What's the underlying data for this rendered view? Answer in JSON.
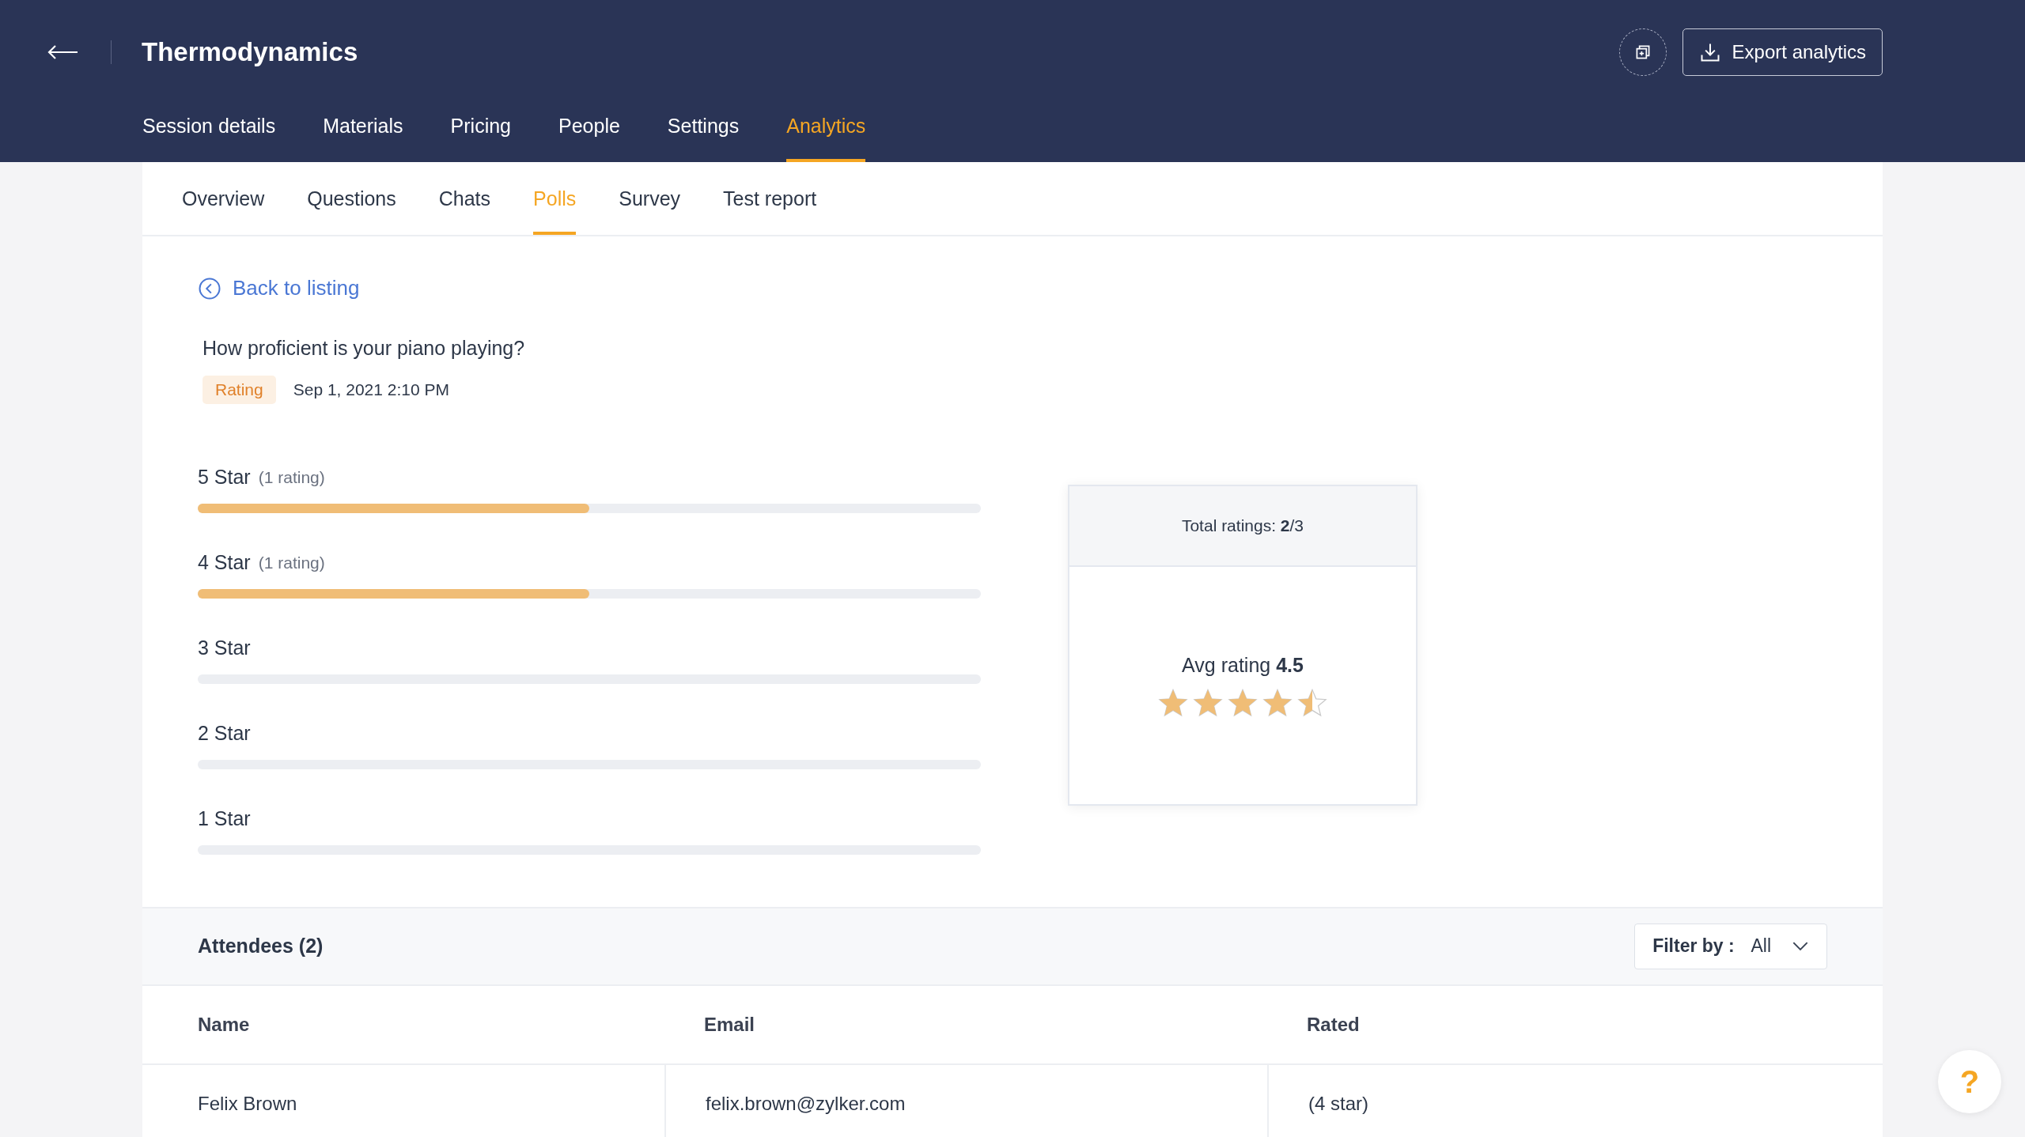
{
  "header": {
    "title": "Thermodynamics",
    "export_button": "Export analytics"
  },
  "nav_tabs": [
    {
      "label": "Session details",
      "selected": false
    },
    {
      "label": "Materials",
      "selected": false
    },
    {
      "label": "Pricing",
      "selected": false
    },
    {
      "label": "People",
      "selected": false
    },
    {
      "label": "Settings",
      "selected": false
    },
    {
      "label": "Analytics",
      "selected": true
    }
  ],
  "sub_tabs": [
    {
      "label": "Overview",
      "selected": false
    },
    {
      "label": "Questions",
      "selected": false
    },
    {
      "label": "Chats",
      "selected": false
    },
    {
      "label": "Polls",
      "selected": true
    },
    {
      "label": "Survey",
      "selected": false
    },
    {
      "label": "Test report",
      "selected": false
    }
  ],
  "back_link": "Back to listing",
  "poll": {
    "question": "How proficient is your piano playing?",
    "type_badge": "Rating",
    "date": "Sep 1, 2021 2:10 PM"
  },
  "rating_rows": [
    {
      "label": "5 Star",
      "count": "(1 rating)",
      "level": 0.5
    },
    {
      "label": "4 Star",
      "count": "(1 rating)",
      "level": 0.5
    },
    {
      "label": "3 Star",
      "level": 0
    },
    {
      "label": "2 Star",
      "level": 0
    },
    {
      "label": "1 Star",
      "level": 0
    }
  ],
  "summary": {
    "total": "Total ratings: **2**/3",
    "average": "Avg rating **4.5**",
    "stars": 4.5
  },
  "attendees": {
    "title": "Attendees (2)",
    "filter_label": "Filter by :",
    "filter_value": "All",
    "columns": [
      "Name",
      "Email",
      "Rated"
    ],
    "rows": [
      [
        "Felix Brown",
        "felix.brown@zylker.com",
        "(4 star)"
      ]
    ]
  },
  "help_button": "?"
}
